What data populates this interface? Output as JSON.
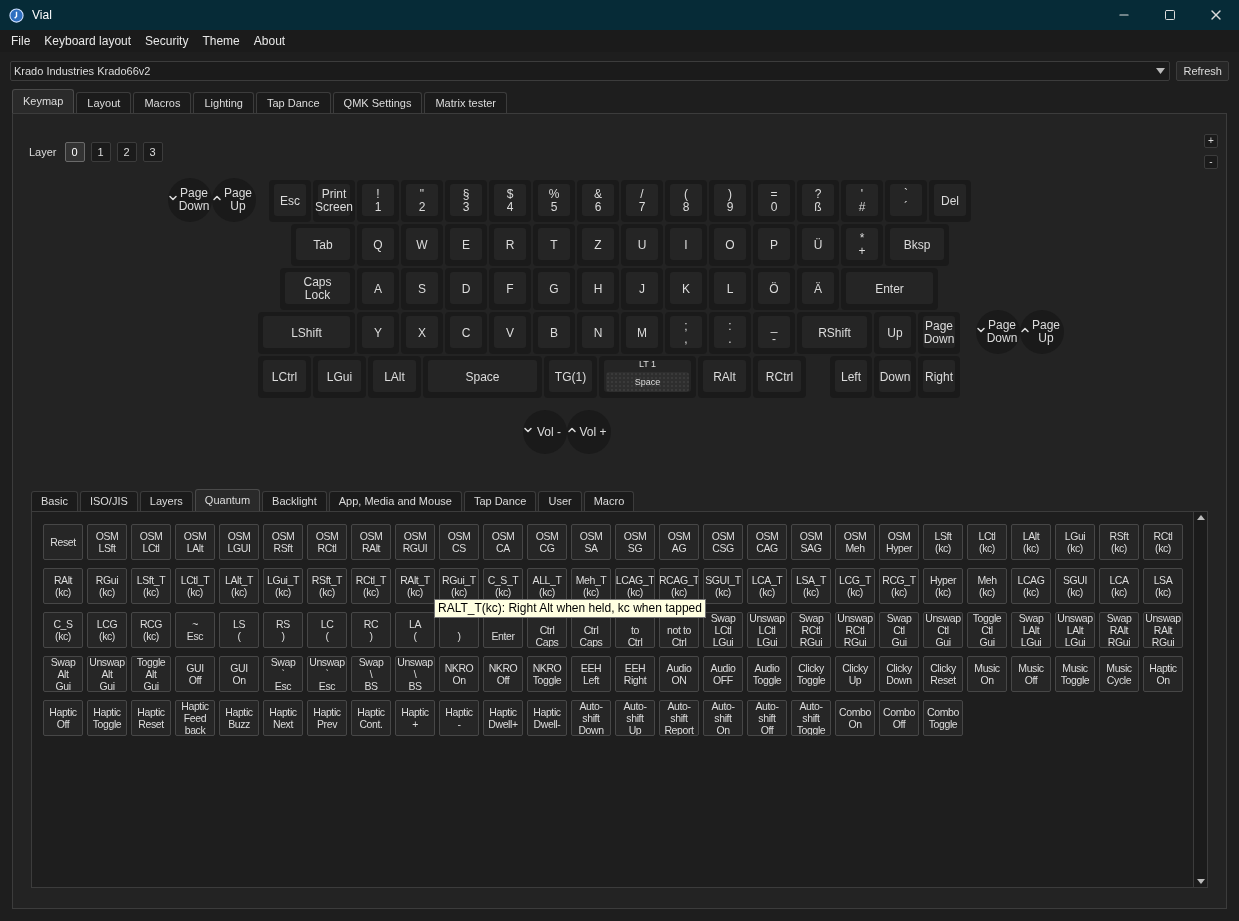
{
  "window": {
    "title": "Vial"
  },
  "menu": [
    "File",
    "Keyboard layout",
    "Security",
    "Theme",
    "About"
  ],
  "device_selector": {
    "value": "Krado Industries Krado66v2"
  },
  "refresh_button": "Refresh",
  "tabs": [
    {
      "label": "Keymap",
      "selected": true
    },
    {
      "label": "Layout",
      "selected": false
    },
    {
      "label": "Macros",
      "selected": false
    },
    {
      "label": "Lighting",
      "selected": false
    },
    {
      "label": "Tap Dance",
      "selected": false
    },
    {
      "label": "QMK Settings",
      "selected": false
    },
    {
      "label": "Matrix tester",
      "selected": false
    }
  ],
  "layer": {
    "label": "Layer",
    "buttons": [
      {
        "label": "0",
        "selected": true
      },
      {
        "label": "1",
        "selected": false
      },
      {
        "label": "2",
        "selected": false
      },
      {
        "label": "3",
        "selected": false
      }
    ]
  },
  "zoom_buttons": [
    "+",
    "-"
  ],
  "keyboard": {
    "key_rows": [
      [
        {
          "label": "Esc"
        },
        {
          "label": "Print\nScreen"
        },
        {
          "label": "!\n1"
        },
        {
          "label": "\"\n2"
        },
        {
          "label": "§\n3"
        },
        {
          "label": "$\n4"
        },
        {
          "label": "%\n5"
        },
        {
          "label": "&\n6"
        },
        {
          "label": "/\n7"
        },
        {
          "label": "(\n8"
        },
        {
          "label": ")\n9"
        },
        {
          "label": "=\n0"
        },
        {
          "label": "?\nß"
        },
        {
          "label": "'\n#"
        },
        {
          "label": "`\n´"
        },
        {
          "label": "Del"
        }
      ],
      [
        {
          "label": "Tab"
        },
        {
          "label": "Q"
        },
        {
          "label": "W"
        },
        {
          "label": "E"
        },
        {
          "label": "R"
        },
        {
          "label": "T"
        },
        {
          "label": "Z"
        },
        {
          "label": "U"
        },
        {
          "label": "I"
        },
        {
          "label": "O"
        },
        {
          "label": "P"
        },
        {
          "label": "Ü"
        },
        {
          "label": "*\n+"
        },
        {
          "label": "Bksp"
        }
      ],
      [
        {
          "label": "Caps\nLock"
        },
        {
          "label": "A"
        },
        {
          "label": "S"
        },
        {
          "label": "D"
        },
        {
          "label": "F"
        },
        {
          "label": "G"
        },
        {
          "label": "H"
        },
        {
          "label": "J"
        },
        {
          "label": "K"
        },
        {
          "label": "L"
        },
        {
          "label": "Ö"
        },
        {
          "label": "Ä"
        },
        {
          "label": "Enter"
        }
      ],
      [
        {
          "label": "LShift"
        },
        {
          "label": "Y"
        },
        {
          "label": "X"
        },
        {
          "label": "C"
        },
        {
          "label": "V"
        },
        {
          "label": "B"
        },
        {
          "label": "N"
        },
        {
          "label": "M"
        },
        {
          "label": ";\n,"
        },
        {
          "label": ":\n."
        },
        {
          "label": "_\n-"
        },
        {
          "label": "RShift"
        },
        {
          "label": "Up"
        },
        {
          "label": "Page\nDown"
        }
      ],
      [
        {
          "label": "LCtrl"
        },
        {
          "label": "LGui"
        },
        {
          "label": "LAlt"
        },
        {
          "label": "Space"
        },
        {
          "label": "TG(1)"
        },
        {
          "label": "Space",
          "top": "LT 1"
        },
        {
          "label": "RAlt"
        },
        {
          "label": "RCtrl"
        },
        {
          "label": "Left"
        },
        {
          "label": "Down"
        },
        {
          "label": "Right"
        }
      ]
    ],
    "encoders": [
      [
        {
          "label": "Page\nDown",
          "kind": "down"
        },
        {
          "label": "Page\nUp",
          "kind": "up"
        }
      ],
      [
        {
          "label": "Page\nDown",
          "kind": "down"
        },
        {
          "label": "Page\nUp",
          "kind": "up"
        }
      ],
      [
        {
          "label": "Vol -",
          "kind": "down"
        },
        {
          "label": "Vol +",
          "kind": "up"
        }
      ]
    ]
  },
  "keycode_tabs": [
    {
      "label": "Basic",
      "selected": false
    },
    {
      "label": "ISO/JIS",
      "selected": false
    },
    {
      "label": "Layers",
      "selected": false
    },
    {
      "label": "Quantum",
      "selected": true
    },
    {
      "label": "Backlight",
      "selected": false
    },
    {
      "label": "App, Media and Mouse",
      "selected": false
    },
    {
      "label": "Tap Dance",
      "selected": false
    },
    {
      "label": "User",
      "selected": false
    },
    {
      "label": "Macro",
      "selected": false
    }
  ],
  "keycodes": [
    "Reset",
    "OSM\nLSft",
    "OSM\nLCtl",
    "OSM\nLAlt",
    "OSM\nLGUI",
    "OSM\nRSft",
    "OSM\nRCtl",
    "OSM\nRAlt",
    "OSM\nRGUI",
    "OSM\nCS",
    "OSM\nCA",
    "OSM\nCG",
    "OSM\nSA",
    "OSM\nSG",
    "OSM\nAG",
    "OSM\nCSG",
    "OSM\nCAG",
    "OSM\nSAG",
    "OSM\nMeh",
    "OSM\nHyper",
    "LSft\n(kc)",
    "LCtl\n(kc)",
    "LAlt\n(kc)",
    "LGui\n(kc)",
    "RSft\n(kc)",
    "RCtl\n(kc)",
    "RAlt\n(kc)",
    "RGui\n(kc)",
    "LSft_T\n(kc)",
    "LCtl_T\n(kc)",
    "LAlt_T\n(kc)",
    "LGui_T\n(kc)",
    "RSft_T\n(kc)",
    "RCtl_T\n(kc)",
    "RAlt_T\n(kc)",
    "RGui_T\n(kc)",
    "C_S_T\n(kc)",
    "ALL_T\n(kc)",
    "Meh_T\n(kc)",
    "LCAG_T\n(kc)",
    "RCAG_T\n(kc)",
    "SGUI_T\n(kc)",
    "LCA_T\n(kc)",
    "LSA_T\n(kc)",
    "LCG_T\n(kc)",
    "RCG_T\n(kc)",
    "Hyper\n(kc)",
    "Meh\n(kc)",
    "LCAG\n(kc)",
    "SGUI\n(kc)",
    "LCA\n(kc)",
    "LSA\n(kc)",
    "C_S\n(kc)",
    "LCG\n(kc)",
    "RCG\n(kc)",
    "~\nEsc",
    "LS\n(",
    "RS\n)",
    "LC\n(",
    "RC\n)",
    "LA\n(",
    "\n)",
    "\nEnter",
    "\nCtrl\nCaps",
    "\nCtrl\nCaps",
    "\nto\nCtrl",
    "\nnot to\nCtrl",
    "Swap\nLCtl\nLGui",
    "Unswap\nLCtl\nLGui",
    "Swap\nRCtl\nRGui",
    "Unswap\nRCtl\nRGui",
    "Swap\nCtl\nGui",
    "Unswap\nCtl\nGui",
    "Toggle\nCtl\nGui",
    "Swap\nLAlt\nLGui",
    "Unswap\nLAlt\nLGui",
    "Swap\nRAlt\nRGui",
    "Unswap\nRAlt\nRGui",
    "Swap\nAlt\nGui",
    "Unswap\nAlt\nGui",
    "Toggle\nAlt\nGui",
    "GUI\nOff",
    "GUI\nOn",
    "Swap\n`\nEsc",
    "Unswap\n`\nEsc",
    "Swap\n\\\nBS",
    "Unswap\n\\\nBS",
    "NKRO\nOn",
    "NKRO\nOff",
    "NKRO\nToggle",
    "EEH\nLeft",
    "EEH\nRight",
    "Audio\nON",
    "Audio\nOFF",
    "Audio\nToggle",
    "Clicky\nToggle",
    "Clicky\nUp",
    "Clicky\nDown",
    "Clicky\nReset",
    "Music\nOn",
    "Music\nOff",
    "Music\nToggle",
    "Music\nCycle",
    "Haptic\nOn",
    "Haptic\nOff",
    "Haptic\nToggle",
    "Haptic\nReset",
    "Haptic\nFeed\nback",
    "Haptic\nBuzz",
    "Haptic\nNext",
    "Haptic\nPrev",
    "Haptic\nCont.",
    "Haptic\n+",
    "Haptic\n-",
    "Haptic\nDwell+",
    "Haptic\nDwell-",
    "Auto-\nshift\nDown",
    "Auto-\nshift\nUp",
    "Auto-\nshift\nReport",
    "Auto-\nshift\nOn",
    "Auto-\nshift\nOff",
    "Auto-\nshift\nToggle",
    "Combo\nOn",
    "Combo\nOff",
    "Combo\nToggle"
  ],
  "tooltip": "RALT_T(kc): Right Alt when held, kc when tapped"
}
